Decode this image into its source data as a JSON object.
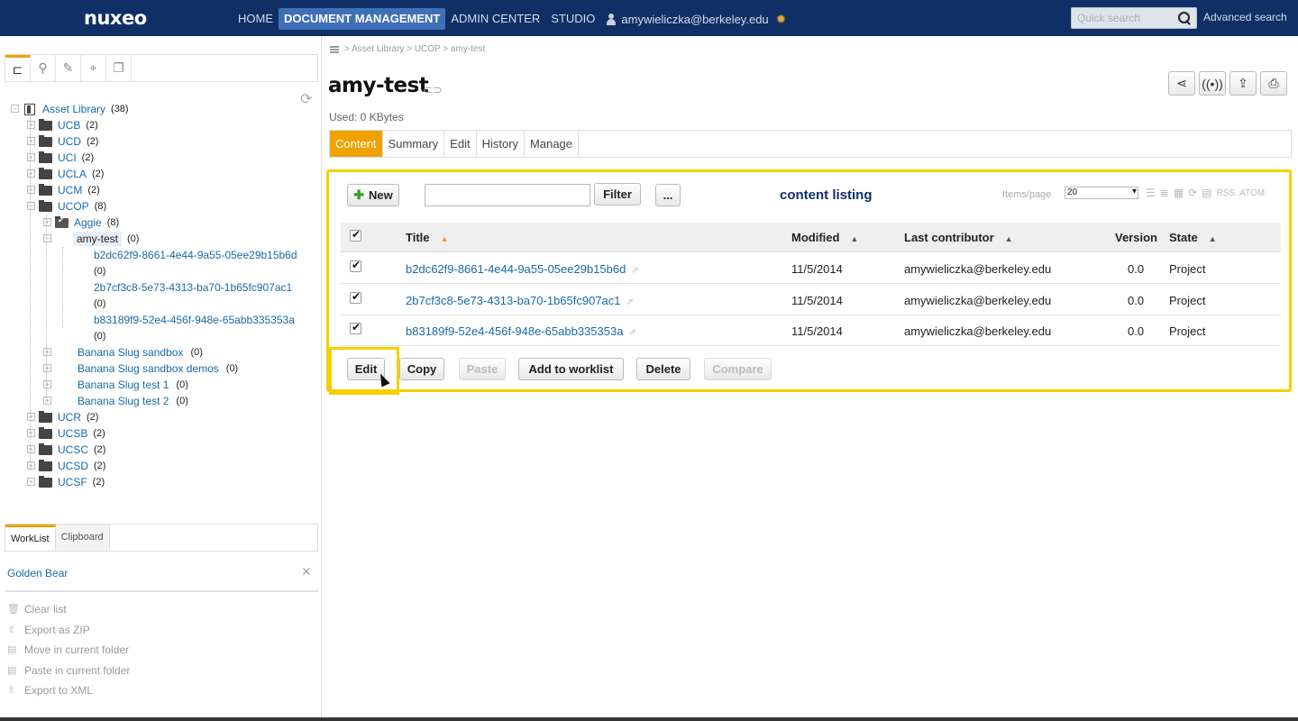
{
  "header": {
    "logo": "nuxeo",
    "nav": [
      "HOME",
      "DOCUMENT MANAGEMENT",
      "ADMIN CENTER",
      "STUDIO"
    ],
    "user": "amywieliczka@berkeley.edu",
    "search_placeholder": "Quick search",
    "advanced_search": "Advanced search"
  },
  "tree": {
    "root": {
      "label": "Asset Library",
      "count": "(38)"
    },
    "top": [
      {
        "label": "UCB",
        "count": "(2)"
      },
      {
        "label": "UCD",
        "count": "(2)"
      },
      {
        "label": "UCI",
        "count": "(2)"
      },
      {
        "label": "UCLA",
        "count": "(2)"
      },
      {
        "label": "UCM",
        "count": "(2)"
      },
      {
        "label": "UCOP",
        "count": "(8)"
      }
    ],
    "ucop_children": {
      "aggie": {
        "label": "Aggie",
        "count": "(8)"
      },
      "amy": {
        "label": "amy-test",
        "count": "(0)"
      },
      "docs": [
        {
          "label": "b2dc62f9-8661-4e44-9a55-05ee29b15b6d",
          "count": "(0)"
        },
        {
          "label": "2b7cf3c8-5e73-4313-ba70-1b65fc907ac1",
          "count": "(0)"
        },
        {
          "label": "b83189f9-52e4-456f-948e-65abb335353a",
          "count": "(0)"
        }
      ],
      "others": [
        {
          "label": "Banana Slug sandbox",
          "count": "(0)"
        },
        {
          "label": "Banana Slug sandbox demos",
          "count": "(0)"
        },
        {
          "label": "Banana Slug test 1",
          "count": "(0)"
        },
        {
          "label": "Banana Slug test 2",
          "count": "(0)"
        }
      ]
    },
    "bottom": [
      {
        "label": "UCR",
        "count": "(2)"
      },
      {
        "label": "UCSB",
        "count": "(2)"
      },
      {
        "label": "UCSC",
        "count": "(2)"
      },
      {
        "label": "UCSD",
        "count": "(2)"
      },
      {
        "label": "UCSF",
        "count": "(2)"
      }
    ]
  },
  "worklist": {
    "tabs": [
      "WorkList",
      "Clipboard"
    ],
    "item": "Golden Bear",
    "actions": [
      "Clear list",
      "Export as ZIP",
      "Move in current folder",
      "Paste in current folder",
      "Export to XML"
    ]
  },
  "main": {
    "breadcrumb": "> Asset Library > UCOP > amy-test",
    "title": "amy-test",
    "used": "Used: 0 KBytes",
    "tabs": [
      "Content",
      "Summary",
      "Edit",
      "History",
      "Manage"
    ],
    "listing": {
      "new_label": "New",
      "filter_label": "Filter",
      "more_label": "...",
      "heading": "content listing",
      "items_per_page_label": "Items/page",
      "items_per_page_value": "20",
      "rss": "RSS",
      "atom": "ATOM",
      "columns": [
        "Title",
        "Modified",
        "Last contributor",
        "Version",
        "State"
      ],
      "rows": [
        {
          "title": "b2dc62f9-8661-4e44-9a55-05ee29b15b6d",
          "modified": "11/5/2014",
          "contributor": "amywieliczka@berkeley.edu",
          "version": "0.0",
          "state": "Project"
        },
        {
          "title": "2b7cf3c8-5e73-4313-ba70-1b65fc907ac1",
          "modified": "11/5/2014",
          "contributor": "amywieliczka@berkeley.edu",
          "version": "0.0",
          "state": "Project"
        },
        {
          "title": "b83189f9-52e4-456f-948e-65abb335353a",
          "modified": "11/5/2014",
          "contributor": "amywieliczka@berkeley.edu",
          "version": "0.0",
          "state": "Project"
        }
      ],
      "bulk_actions": [
        "Edit",
        "Copy",
        "Paste",
        "Add to worklist",
        "Delete",
        "Compare"
      ]
    }
  },
  "colors": {
    "header_bg": "#0f2f66",
    "accent": "#f0a200",
    "highlight": "#f5d000",
    "link": "#1a6aa8"
  }
}
